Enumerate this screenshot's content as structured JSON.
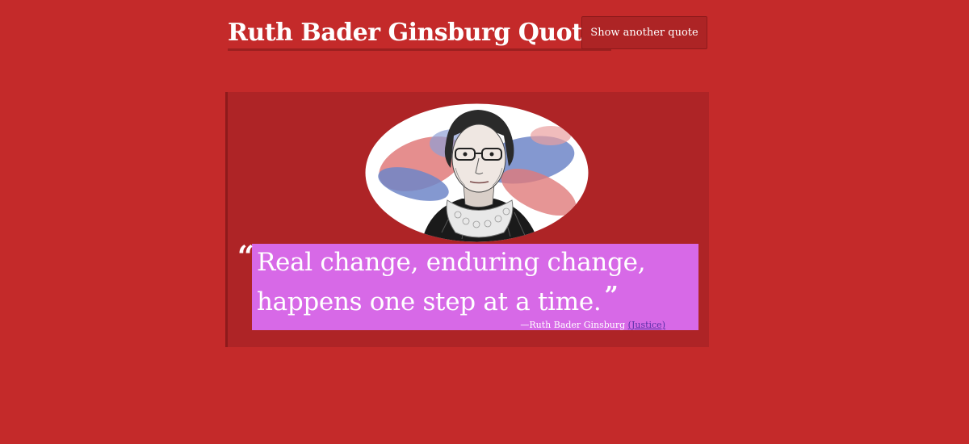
{
  "header": {
    "title": "Ruth Bader Ginsburg Quotes",
    "new_quote_label": "Show another quote"
  },
  "quote": {
    "open_mark": "“",
    "text": "Real change, enduring change, happens one step at a time.",
    "close_mark": "”",
    "attribution_prefix": "—Ruth Bader Ginsburg",
    "role": "(Justice)"
  },
  "colors": {
    "background": "#c42a2a",
    "card": "#ae2426",
    "highlight": "#d769e7",
    "link": "#5a2fa8"
  },
  "portrait": {
    "icon": "ruth-bader-ginsburg-portrait"
  }
}
